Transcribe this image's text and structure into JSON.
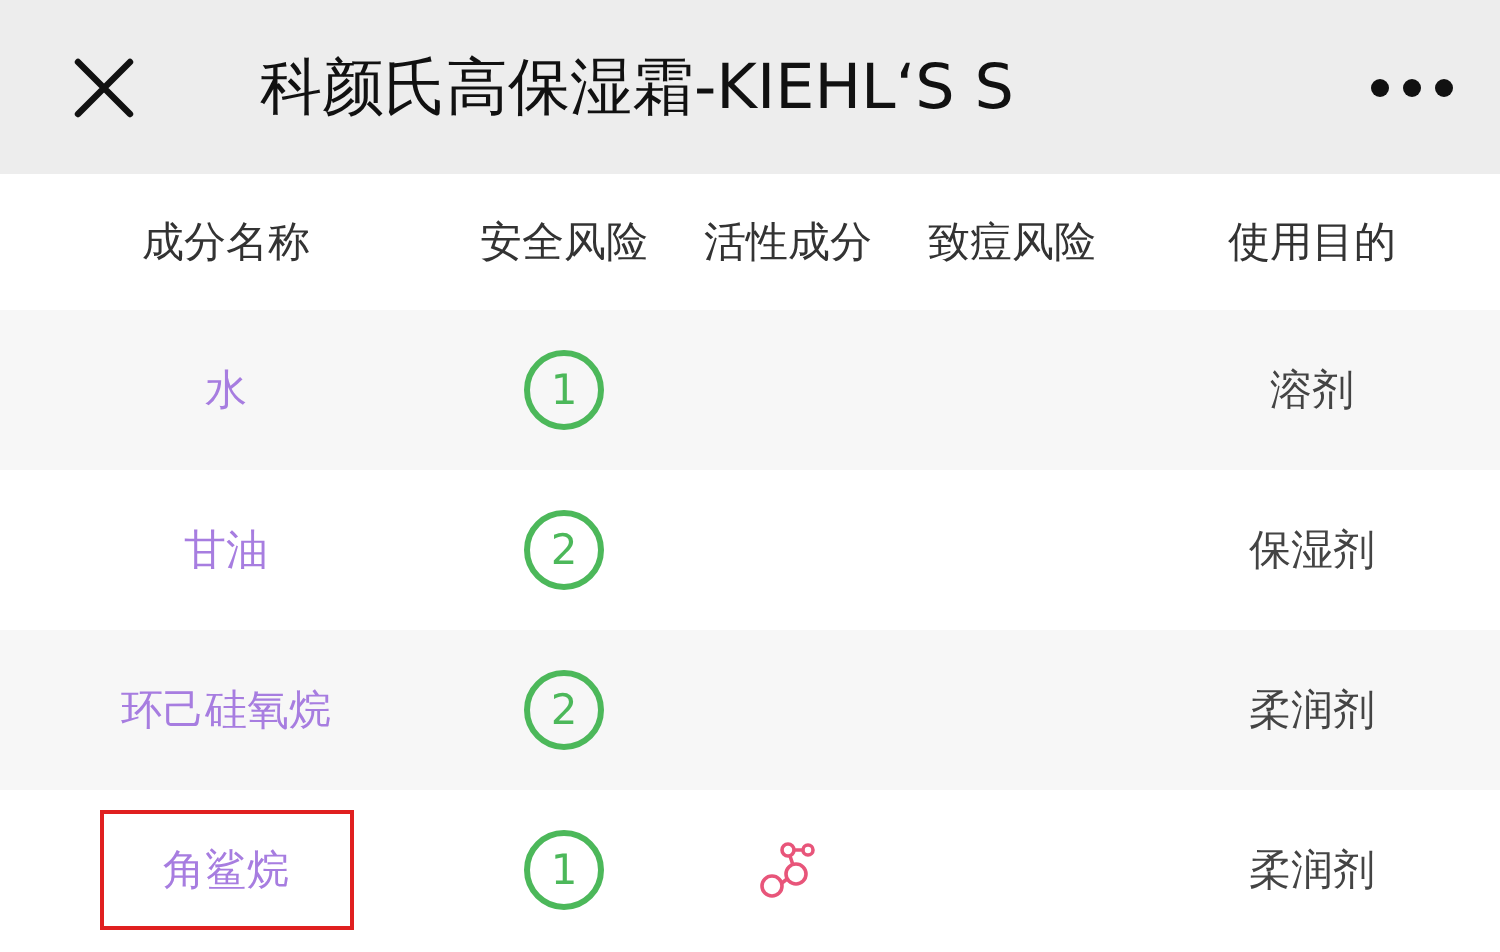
{
  "nav": {
    "title": "科颜氏高保湿霜-KIEHL‘S S"
  },
  "table": {
    "columns": [
      "成分名称",
      "安全风险",
      "活性成分",
      "致痘风险",
      "使用目的"
    ],
    "rows": [
      {
        "name": "水",
        "risk": "1",
        "active": false,
        "purpose": "溶剂",
        "highlighted": false
      },
      {
        "name": "甘油",
        "risk": "2",
        "active": false,
        "purpose": "保湿剂",
        "highlighted": false
      },
      {
        "name": "环己硅氧烷",
        "risk": "2",
        "active": false,
        "purpose": "柔润剂",
        "highlighted": false
      },
      {
        "name": "角鲨烷",
        "risk": "1",
        "active": true,
        "purpose": "柔润剂",
        "highlighted": true
      }
    ]
  }
}
